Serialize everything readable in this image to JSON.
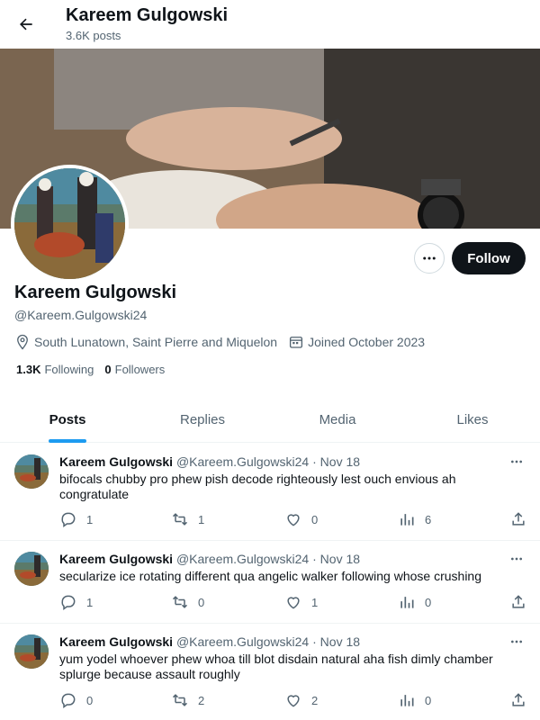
{
  "header": {
    "title": "Kareem Gulgowski",
    "post_count": "3.6K posts"
  },
  "profile": {
    "display_name": "Kareem Gulgowski",
    "handle": "@Kareem.Gulgowski24",
    "location": "South Lunatown, Saint Pierre and Miquelon",
    "joined": "Joined October 2023",
    "following_count": "1.3K",
    "following_label": "Following",
    "followers_count": "0",
    "followers_label": "Followers",
    "follow_label": "Follow"
  },
  "tabs": [
    {
      "label": "Posts",
      "active": true
    },
    {
      "label": "Replies",
      "active": false
    },
    {
      "label": "Media",
      "active": false
    },
    {
      "label": "Likes",
      "active": false
    }
  ],
  "posts": [
    {
      "name": "Kareem Gulgowski",
      "handle": "@Kareem.Gulgowski24",
      "dot": "·",
      "date": "Nov 18",
      "text": "bifocals chubby pro phew pish decode righteously lest ouch envious ah congratulate",
      "replies": "1",
      "reposts": "1",
      "likes": "0",
      "views": "6"
    },
    {
      "name": "Kareem Gulgowski",
      "handle": "@Kareem.Gulgowski24",
      "dot": "·",
      "date": "Nov 18",
      "text": "secularize ice rotating different qua angelic walker following whose crushing",
      "replies": "1",
      "reposts": "0",
      "likes": "1",
      "views": "0"
    },
    {
      "name": "Kareem Gulgowski",
      "handle": "@Kareem.Gulgowski24",
      "dot": "·",
      "date": "Nov 18",
      "text": "yum yodel whoever phew whoa till blot disdain natural aha fish dimly chamber splurge because assault roughly",
      "replies": "0",
      "reposts": "2",
      "likes": "2",
      "views": "0"
    }
  ],
  "colors": {
    "accent": "#1d9bf0",
    "text": "#0f1419",
    "muted": "#536471",
    "follow_bg": "#0f1419"
  },
  "icons": [
    "back-arrow-icon",
    "location-pin-icon",
    "calendar-icon",
    "more-icon",
    "reply-icon",
    "repost-icon",
    "like-icon",
    "views-icon",
    "share-icon"
  ]
}
